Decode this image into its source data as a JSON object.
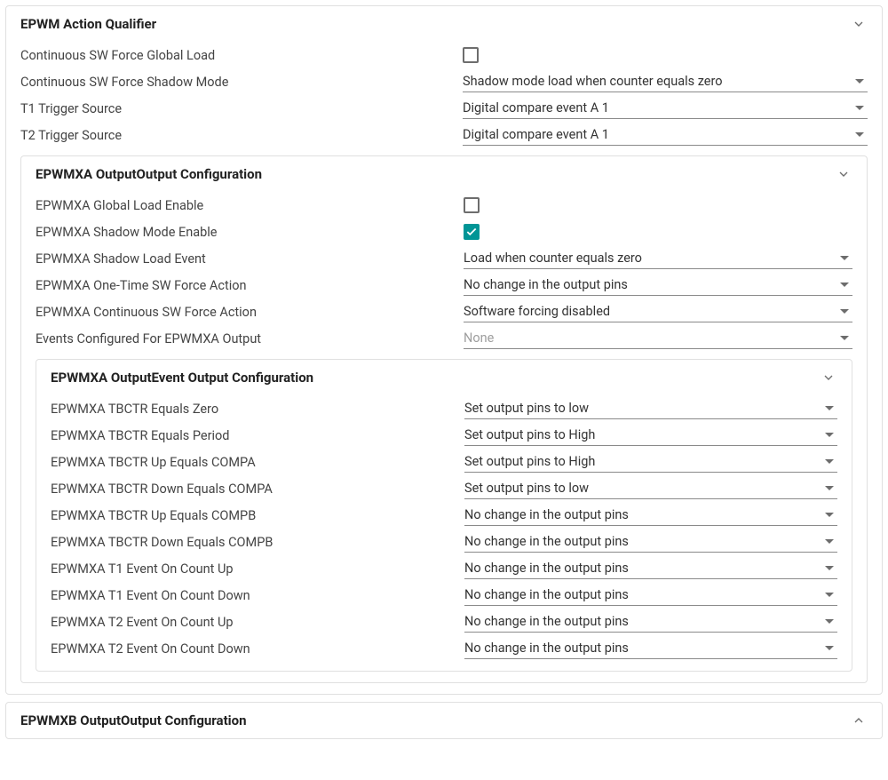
{
  "section1": {
    "title": "EPWM Action Qualifier",
    "fields": {
      "cswf_global_load": {
        "label": "Continuous SW Force Global Load",
        "checked": false
      },
      "cswf_shadow_mode": {
        "label": "Continuous SW Force Shadow Mode",
        "value": "Shadow mode load when counter equals zero"
      },
      "t1_trigger": {
        "label": "T1 Trigger Source",
        "value": "Digital compare event A 1"
      },
      "t2_trigger": {
        "label": "T2 Trigger Source",
        "value": "Digital compare event A 1"
      }
    },
    "sub_a": {
      "title": "EPWMXA OutputOutput Configuration",
      "fields": {
        "global_load_enable": {
          "label": "EPWMXA Global Load Enable",
          "checked": false
        },
        "shadow_mode_enable": {
          "label": "EPWMXA Shadow Mode Enable",
          "checked": true
        },
        "shadow_load_event": {
          "label": "EPWMXA Shadow Load Event",
          "value": "Load when counter equals zero"
        },
        "onetime_sw_force": {
          "label": "EPWMXA One-Time SW Force Action",
          "value": "No change in the output pins"
        },
        "continuous_sw_force": {
          "label": "EPWMXA Continuous SW Force Action",
          "value": "Software forcing disabled"
        },
        "events_configured": {
          "label": "Events Configured For EPWMXA Output",
          "value": "None",
          "placeholder": true
        }
      },
      "sub_events": {
        "title": "EPWMXA OutputEvent Output Configuration",
        "fields": {
          "tbctr_zero": {
            "label": "EPWMXA TBCTR Equals Zero",
            "value": "Set output pins to low"
          },
          "tbctr_period": {
            "label": "EPWMXA TBCTR Equals Period",
            "value": "Set output pins to High"
          },
          "tbctr_up_compa": {
            "label": "EPWMXA TBCTR Up Equals COMPA",
            "value": "Set output pins to High"
          },
          "tbctr_down_compa": {
            "label": "EPWMXA TBCTR Down Equals COMPA",
            "value": "Set output pins to low"
          },
          "tbctr_up_compb": {
            "label": "EPWMXA TBCTR Up Equals COMPB",
            "value": "No change in the output pins"
          },
          "tbctr_down_compb": {
            "label": "EPWMXA TBCTR Down Equals COMPB",
            "value": "No change in the output pins"
          },
          "t1_count_up": {
            "label": "EPWMXA T1 Event On Count Up",
            "value": "No change in the output pins"
          },
          "t1_count_down": {
            "label": "EPWMXA T1 Event On Count Down",
            "value": "No change in the output pins"
          },
          "t2_count_up": {
            "label": "EPWMXA T2 Event On Count Up",
            "value": "No change in the output pins"
          },
          "t2_count_down": {
            "label": "EPWMXA T2 Event On Count Down",
            "value": "No change in the output pins"
          }
        }
      }
    }
  },
  "section_b": {
    "title": "EPWMXB OutputOutput Configuration"
  }
}
